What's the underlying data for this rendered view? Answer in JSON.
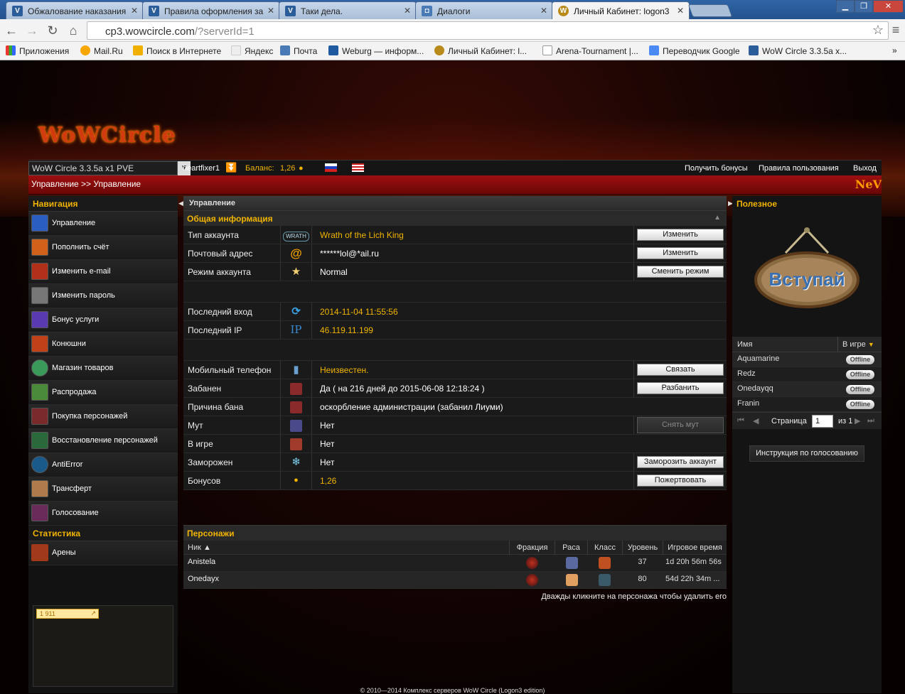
{
  "browser": {
    "tabs": [
      {
        "title": "Обжалование наказания",
        "icon": "wowcircle-favicon"
      },
      {
        "title": "Правила оформления за",
        "icon": "wowcircle-favicon"
      },
      {
        "title": "Таки дела.",
        "icon": "wowcircle-favicon"
      },
      {
        "title": "Диалоги",
        "icon": "vk-favicon"
      },
      {
        "title": "Личный Кабинет: logon3",
        "icon": "wow-favicon"
      }
    ],
    "url_host": "cp3.wowcircle.com",
    "url_path": "/?serverId=1",
    "bookmarks": [
      "Приложения",
      "Mail.Ru",
      "Поиск в Интернете",
      "Яндекс",
      "Почта",
      "Weburg — информ...",
      "Личный Кабинет: l...",
      "Arena-Tournament |...",
      "Переводчик Google",
      "WoW Circle 3.3.5a x..."
    ]
  },
  "site": {
    "logo": "WoWCircle",
    "realm": "WoW Circle 3.3.5a x1 PVE",
    "username": "heartfixer1",
    "balance_label": "Баланс:",
    "balance_value": "1,26",
    "top_links": [
      "Получить бонусы",
      "Правила пользования",
      "Выход"
    ],
    "breadcrumb": "Управление >> Управление",
    "corner_logo": "NeV"
  },
  "nav": {
    "title": "Навигация",
    "items": [
      "Управление",
      "Пополнить счёт",
      "Изменить e-mail",
      "Изменить пароль",
      "Бонус услуги",
      "Конюшни",
      "Магазин товаров",
      "Распродажа",
      "Покупка персонажей",
      "Восстановление персонажей",
      "AntiError",
      "Трансферт",
      "Голосование"
    ],
    "stats_title": "Статистика",
    "stats_items": [
      "Арены"
    ],
    "counter": "1 911"
  },
  "main": {
    "panel_title": "Управление",
    "info_title": "Общая информация",
    "rows": {
      "account_type": {
        "label": "Тип аккаунта",
        "value": "Wrath of the Lich King",
        "icon": "WRATH",
        "action": "Изменить"
      },
      "email": {
        "label": "Почтовый адрес",
        "value": "******lol@*ail.ru",
        "icon": "@",
        "action": "Изменить"
      },
      "mode": {
        "label": "Режим аккаунта",
        "value": "Normal",
        "icon": "★",
        "action": "Сменить режим"
      },
      "last_login": {
        "label": "Последний вход",
        "value": "2014-11-04 11:55:56",
        "icon": "⟳"
      },
      "last_ip": {
        "label": "Последний IP",
        "value": "46.119.11.199",
        "icon": "IP"
      },
      "phone": {
        "label": "Мобильный телефон",
        "value": "Неизвестен.",
        "icon": "▮",
        "action": "Связать"
      },
      "banned": {
        "label": "Забанен",
        "value": "Да ( на 216 дней до 2015-06-08 12:18:24 )",
        "action": "Разбанить"
      },
      "ban_reason": {
        "label": "Причина бана",
        "value": "оскорбление администрации (забанил Лиуми)"
      },
      "mute": {
        "label": "Мут",
        "value": "Нет",
        "action": "Снять мут"
      },
      "in_game": {
        "label": "В игре",
        "value": "Нет"
      },
      "frozen": {
        "label": "Заморожен",
        "value": "Нет",
        "icon": "❄",
        "action": "Заморозить аккаунт"
      },
      "bonuses": {
        "label": "Бонусов",
        "value": "1,26",
        "action": "Пожертвовать"
      }
    },
    "chars_title": "Персонажи",
    "chars_columns": [
      "Ник ▲",
      "Фракция",
      "Раса",
      "Класс",
      "Уровень",
      "Игровое время"
    ],
    "characters": [
      {
        "name": "Anistela",
        "level": "37",
        "time": "1d 20h 56m 56s"
      },
      {
        "name": "Onedayx",
        "level": "80",
        "time": "54d 22h 34m ..."
      }
    ],
    "hint": "Дважды кликните на персонажа чтобы удалить его"
  },
  "right": {
    "title": "Полезное",
    "sign_text": "Вступай",
    "col_name": "Имя",
    "col_status": "В игре",
    "players": [
      "Aquamarine",
      "Redz",
      "Onedayqq",
      "Franin"
    ],
    "status": "Offline",
    "page_label": "Страница",
    "page_value": "1",
    "page_of": "из 1",
    "vote_button": "Инструкция по голосованию"
  },
  "footer": "© 2010—2014 Комплекс серверов WoW Circle (Logon3 edition)"
}
